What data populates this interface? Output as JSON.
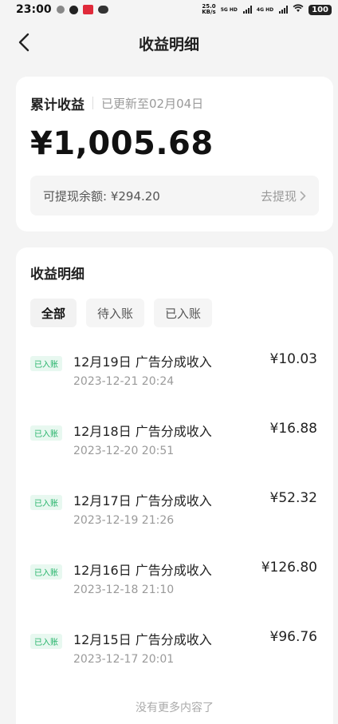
{
  "status_bar": {
    "time": "23:00",
    "net_speed_value": "25.0",
    "net_speed_unit": "KB/s",
    "signal_label_1": "5G HD",
    "signal_label_2": "4G HD",
    "battery": "100"
  },
  "header": {
    "title": "收益明细"
  },
  "summary": {
    "title": "累计收益",
    "updated": "已更新至02月04日",
    "total": "¥1,005.68",
    "withdrawable": "可提现余额: ¥294.20",
    "withdraw_link": "去提现"
  },
  "details": {
    "title": "收益明细",
    "tabs": [
      {
        "label": "全部"
      },
      {
        "label": "待入账"
      },
      {
        "label": "已入账"
      }
    ],
    "records": [
      {
        "badge": "已入账",
        "title": "12月19日 广告分成收入",
        "time": "2023-12-21 20:24",
        "amount": "¥10.03"
      },
      {
        "badge": "已入账",
        "title": "12月18日 广告分成收入",
        "time": "2023-12-20 20:51",
        "amount": "¥16.88"
      },
      {
        "badge": "已入账",
        "title": "12月17日 广告分成收入",
        "time": "2023-12-19 21:26",
        "amount": "¥52.32"
      },
      {
        "badge": "已入账",
        "title": "12月16日 广告分成收入",
        "time": "2023-12-18 21:10",
        "amount": "¥126.80"
      },
      {
        "badge": "已入账",
        "title": "12月15日 广告分成收入",
        "time": "2023-12-17 20:01",
        "amount": "¥96.76"
      }
    ],
    "no_more": "没有更多内容了"
  },
  "colors": {
    "badge_text": "#26b36a",
    "badge_bg": "#e8f8f0"
  }
}
